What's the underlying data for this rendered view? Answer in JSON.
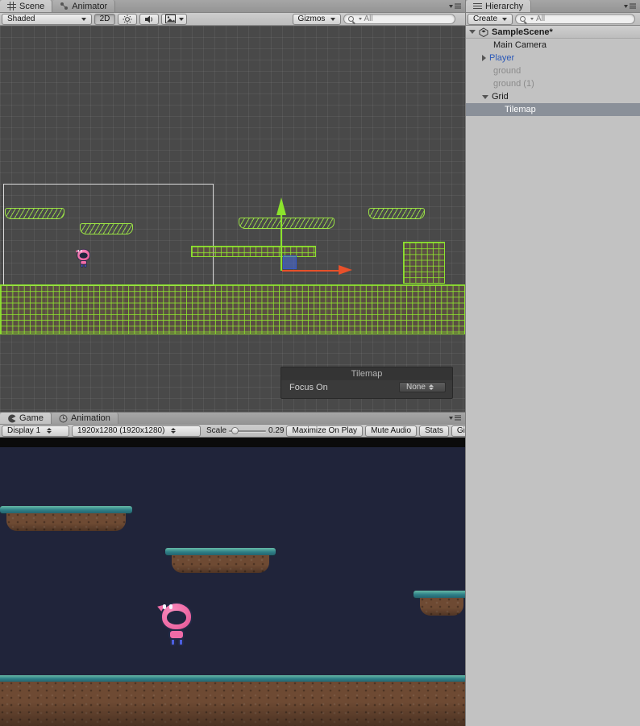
{
  "scene": {
    "tabs": [
      "Scene",
      "Animator"
    ],
    "toolbar": {
      "shaded": "Shaded",
      "mode2d": "2D",
      "gizmos": "Gizmos",
      "search": "All"
    },
    "overlay": {
      "title": "Tilemap",
      "focus_on": "Focus On",
      "none": "None"
    }
  },
  "game": {
    "tabs": [
      "Game",
      "Animation"
    ],
    "toolbar": {
      "display": "Display 1",
      "resolution": "1920x1280 (1920x1280)",
      "scale_label": "Scale",
      "scale_value": "0.29",
      "maximize_on_play": "Maximize On Play",
      "mute_audio": "Mute Audio",
      "stats": "Stats",
      "gizmos": "Gizmos"
    }
  },
  "hierarchy": {
    "tab": "Hierarchy",
    "create": "Create",
    "search": "All",
    "items": [
      {
        "label": "SampleScene*"
      },
      {
        "label": "Main Camera"
      },
      {
        "label": "Player"
      },
      {
        "label": "ground"
      },
      {
        "label": "ground (1)"
      },
      {
        "label": "Grid"
      },
      {
        "label": "Tilemap"
      }
    ]
  },
  "colors": {
    "selection_gray": "#8a9099",
    "prefab_blue": "#2a58b8",
    "tilemap_green": "#8ee62e",
    "axis_green": "#8be32c",
    "axis_red": "#e8502a",
    "game_bg": "#20243a"
  }
}
